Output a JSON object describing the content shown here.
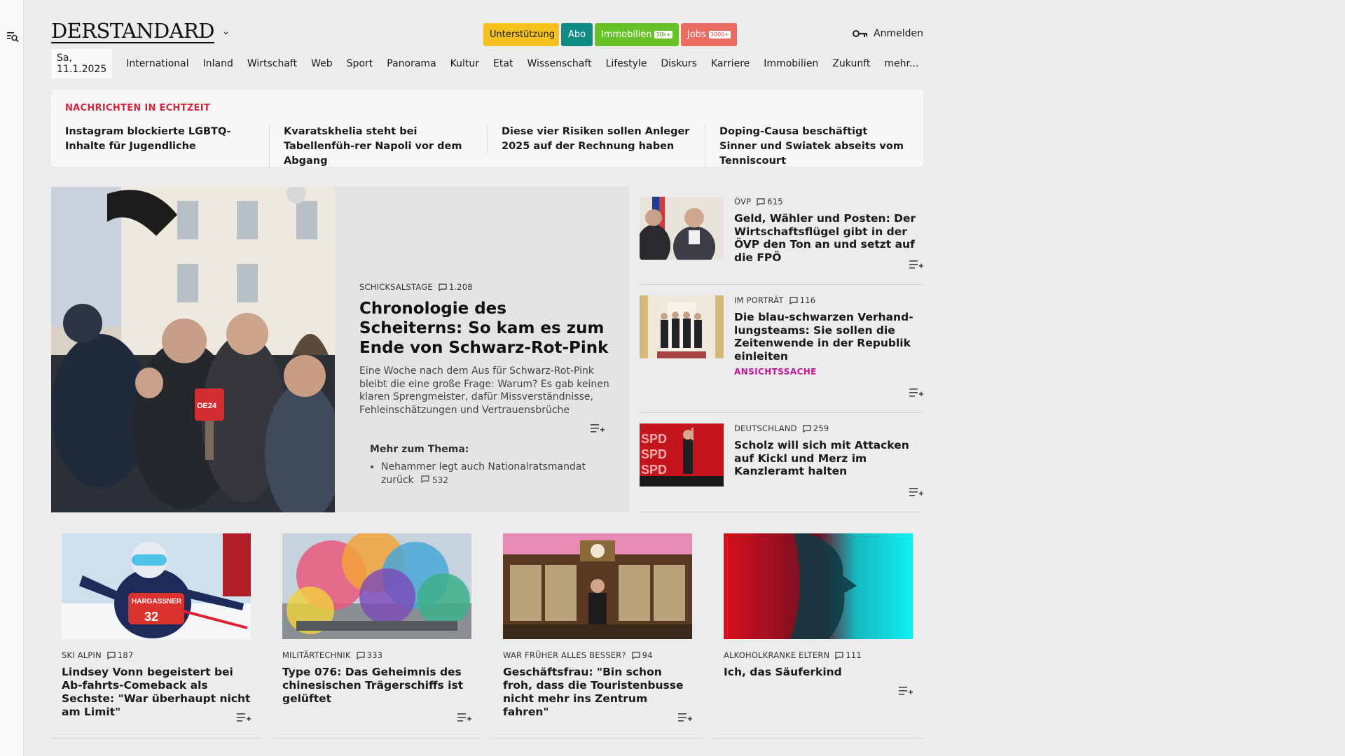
{
  "sidebar": {
    "icon": "menu-search-icon"
  },
  "header": {
    "logo": "DERSTANDARD",
    "support_label": "Unterstützung",
    "abo_label": "Abo",
    "immo_label": "Immobilien",
    "immo_badge": "30k+",
    "jobs_label": "Jobs",
    "jobs_badge": "3000+",
    "login_label": "Anmelden"
  },
  "nav": {
    "date": "Sa, 11.1.2025",
    "items": [
      "International",
      "Inland",
      "Wirtschaft",
      "Web",
      "Sport",
      "Panorama",
      "Kultur",
      "Etat",
      "Wissenschaft",
      "Lifestyle",
      "Diskurs",
      "Karriere",
      "Immobilien",
      "Zukunft",
      "mehr..."
    ]
  },
  "ticker": {
    "label": "NACHRICHTEN IN ECHTZEIT",
    "items": [
      "Instagram blockierte LGBTQ-Inhalte für Jugendliche",
      "Kvaratskhelia steht bei Tabellenfüh-rer Napoli vor dem Abgang",
      "Diese vier Risiken sollen Anleger 2025 auf der Rechnung haben",
      "Doping-Causa beschäftigt Sinner und Swiatek abseits vom Tenniscourt"
    ]
  },
  "lead": {
    "kicker": "SCHICKSALSTAGE",
    "comments": "1.208",
    "title": "Chronologie des Scheiterns: So kam es zum Ende von Schwarz-Rot-Pink",
    "teaser": "Eine Woche nach dem Aus für Schwarz-Rot-Pink bleibt die eine große Frage: Warum? Es gab keinen klaren Sprengmeister, dafür Missverständnisse, Fehleinschätzungen und Vertrauensbrüche",
    "more_heading": "Mehr zum Thema:",
    "more_item": "Nehammer legt auch Nationalratsmandat zurück",
    "more_comments": "532",
    "mic_label": "OE24"
  },
  "side": [
    {
      "kicker": "ÖVP",
      "comments": "615",
      "title": "Geld, Wähler und Posten: Der Wirtschaftsflügel gibt in der ÖVP den Ton an und setzt auf die FPÖ",
      "tag": ""
    },
    {
      "kicker": "IM PORTRÄT",
      "comments": "116",
      "title": "Die blau-schwarzen Verhand-lungsteams: Sie sollen die Zeitenwende in der Republik einleiten",
      "tag": "ANSICHTSSACHE"
    },
    {
      "kicker": "DEUTSCHLAND",
      "comments": "259",
      "title": "Scholz will sich mit Attacken auf Kickl und Merz im Kanzleramt halten",
      "tag": ""
    }
  ],
  "cards": [
    {
      "kicker": "SKI ALPIN",
      "comments": "187",
      "title": "Lindsey Vonn begeistert bei Ab-fahrts-Comeback als Sechste: \"War überhaupt nicht am Limit\""
    },
    {
      "kicker": "MILITÄRTECHNIK",
      "comments": "333",
      "title": "Type 076: Das Geheimnis des chinesischen Trägerschiffs ist gelüftet"
    },
    {
      "kicker": "WAR FRÜHER ALLES BESSER?",
      "comments": "94",
      "title": "Geschäftsfrau: \"Bin schon froh, dass die Touristenbusse nicht mehr ins Zentrum fahren\""
    },
    {
      "kicker": "ALKOHOLKRANKE ELTERN",
      "comments": "111",
      "title": "Ich, das Säuferkind"
    }
  ],
  "image_texts": {
    "spd": [
      "SPD",
      "SPD",
      "SPD"
    ],
    "bib": "32",
    "bib_sponsor": "HARGASSNER"
  },
  "colors": {
    "ticker_label": "#d0263e",
    "tag": "#c0189a",
    "support": "#f5c11e",
    "abo": "#0e8c83",
    "immo": "#66c226",
    "jobs": "#ec6b60"
  }
}
